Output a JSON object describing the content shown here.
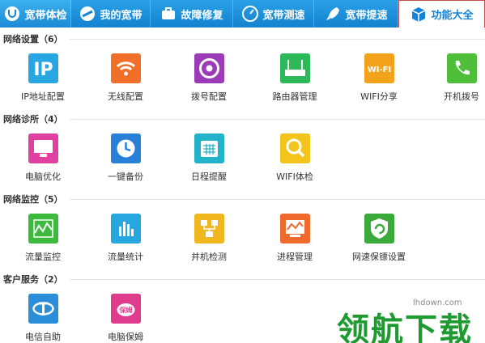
{
  "tabs": [
    {
      "label": "宽带体检"
    },
    {
      "label": "我的宽带"
    },
    {
      "label": "故障修复"
    },
    {
      "label": "宽带测速"
    },
    {
      "label": "宽带提速"
    },
    {
      "label": "功能大全"
    }
  ],
  "sections": [
    {
      "title": "网络设置（6）",
      "items": [
        {
          "label": "IP地址配置",
          "icon": "ip-icon",
          "color": "#28a6e2"
        },
        {
          "label": "无线配置",
          "icon": "wifi-icon",
          "color": "#f26f2a"
        },
        {
          "label": "拨号配置",
          "icon": "dial-icon",
          "color": "#9b3bb8"
        },
        {
          "label": "路由器管理",
          "icon": "router-icon",
          "color": "#2db85a"
        },
        {
          "label": "WIFI分享",
          "icon": "wifi-share-icon",
          "color": "#f2a31b"
        },
        {
          "label": "开机拨号",
          "icon": "phone-icon",
          "color": "#4fbf3a"
        }
      ]
    },
    {
      "title": "网络诊所（4）",
      "items": [
        {
          "label": "电脑优化",
          "icon": "monitor-icon",
          "color": "#e040a0"
        },
        {
          "label": "一键备份",
          "icon": "clock-backup-icon",
          "color": "#2880d8"
        },
        {
          "label": "日程提醒",
          "icon": "calendar-icon",
          "color": "#22b3c8"
        },
        {
          "label": "WIFI体检",
          "icon": "wifi-search-icon",
          "color": "#f3c51c"
        }
      ]
    },
    {
      "title": "网络监控（5）",
      "items": [
        {
          "label": "流量监控",
          "icon": "traffic-monitor-icon",
          "color": "#3dba3d"
        },
        {
          "label": "流量统计",
          "icon": "bar-stats-icon",
          "color": "#26a7e0"
        },
        {
          "label": "并机检测",
          "icon": "network-check-icon",
          "color": "#f0b81e"
        },
        {
          "label": "进程管理",
          "icon": "process-icon",
          "color": "#ef6a2c"
        },
        {
          "label": "网速保镖设置",
          "icon": "shield-icon",
          "color": "#3aaa3a"
        }
      ]
    },
    {
      "title": "客户服务（2）",
      "items": [
        {
          "label": "电信自助",
          "icon": "telecom-icon",
          "color": "#2a8fd8"
        },
        {
          "label": "电脑保姆",
          "icon": "nanny-icon",
          "color": "#e03c8e"
        }
      ]
    }
  ],
  "watermark": {
    "url": "lhdown.com",
    "text": "领航下载"
  }
}
